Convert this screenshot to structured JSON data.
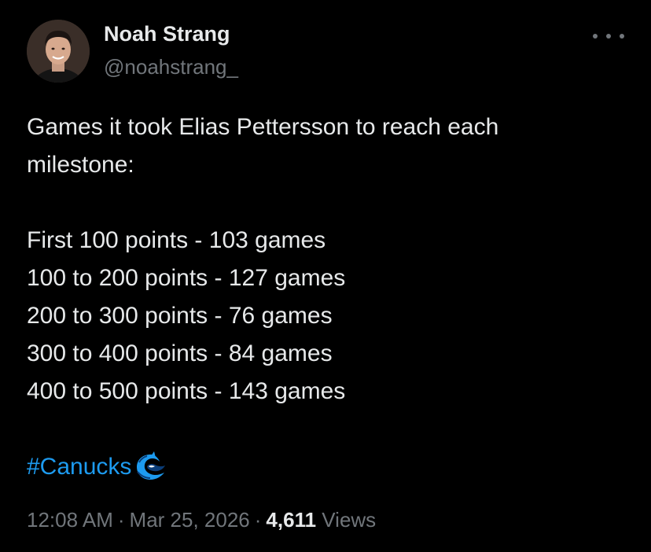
{
  "author": {
    "display_name": "Noah Strang",
    "handle": "@noahstrang_"
  },
  "icons": {
    "avatar": "profile-photo",
    "more": "more-horizontal-icon",
    "hashtag_emoji": "canucks-orca-logo"
  },
  "tweet": {
    "intro_line1": "Games it took Elias Pettersson to reach each",
    "intro_line2": "milestone:",
    "milestones": [
      "First 100 points - 103 games",
      "100 to 200 points - 127 games",
      "200 to 300 points - 76 games",
      "300 to 400 points - 84 games",
      "400 to 500 points - 143 games"
    ],
    "hashtag": "#Canucks"
  },
  "meta": {
    "time": "12:08 AM",
    "separator": "·",
    "date": "Mar 25, 2026",
    "views_count": "4,611",
    "views_label": "Views"
  },
  "colors": {
    "background": "#000000",
    "primary_text": "#e7e9ea",
    "secondary_text": "#71767b",
    "link": "#1d9bf0"
  }
}
